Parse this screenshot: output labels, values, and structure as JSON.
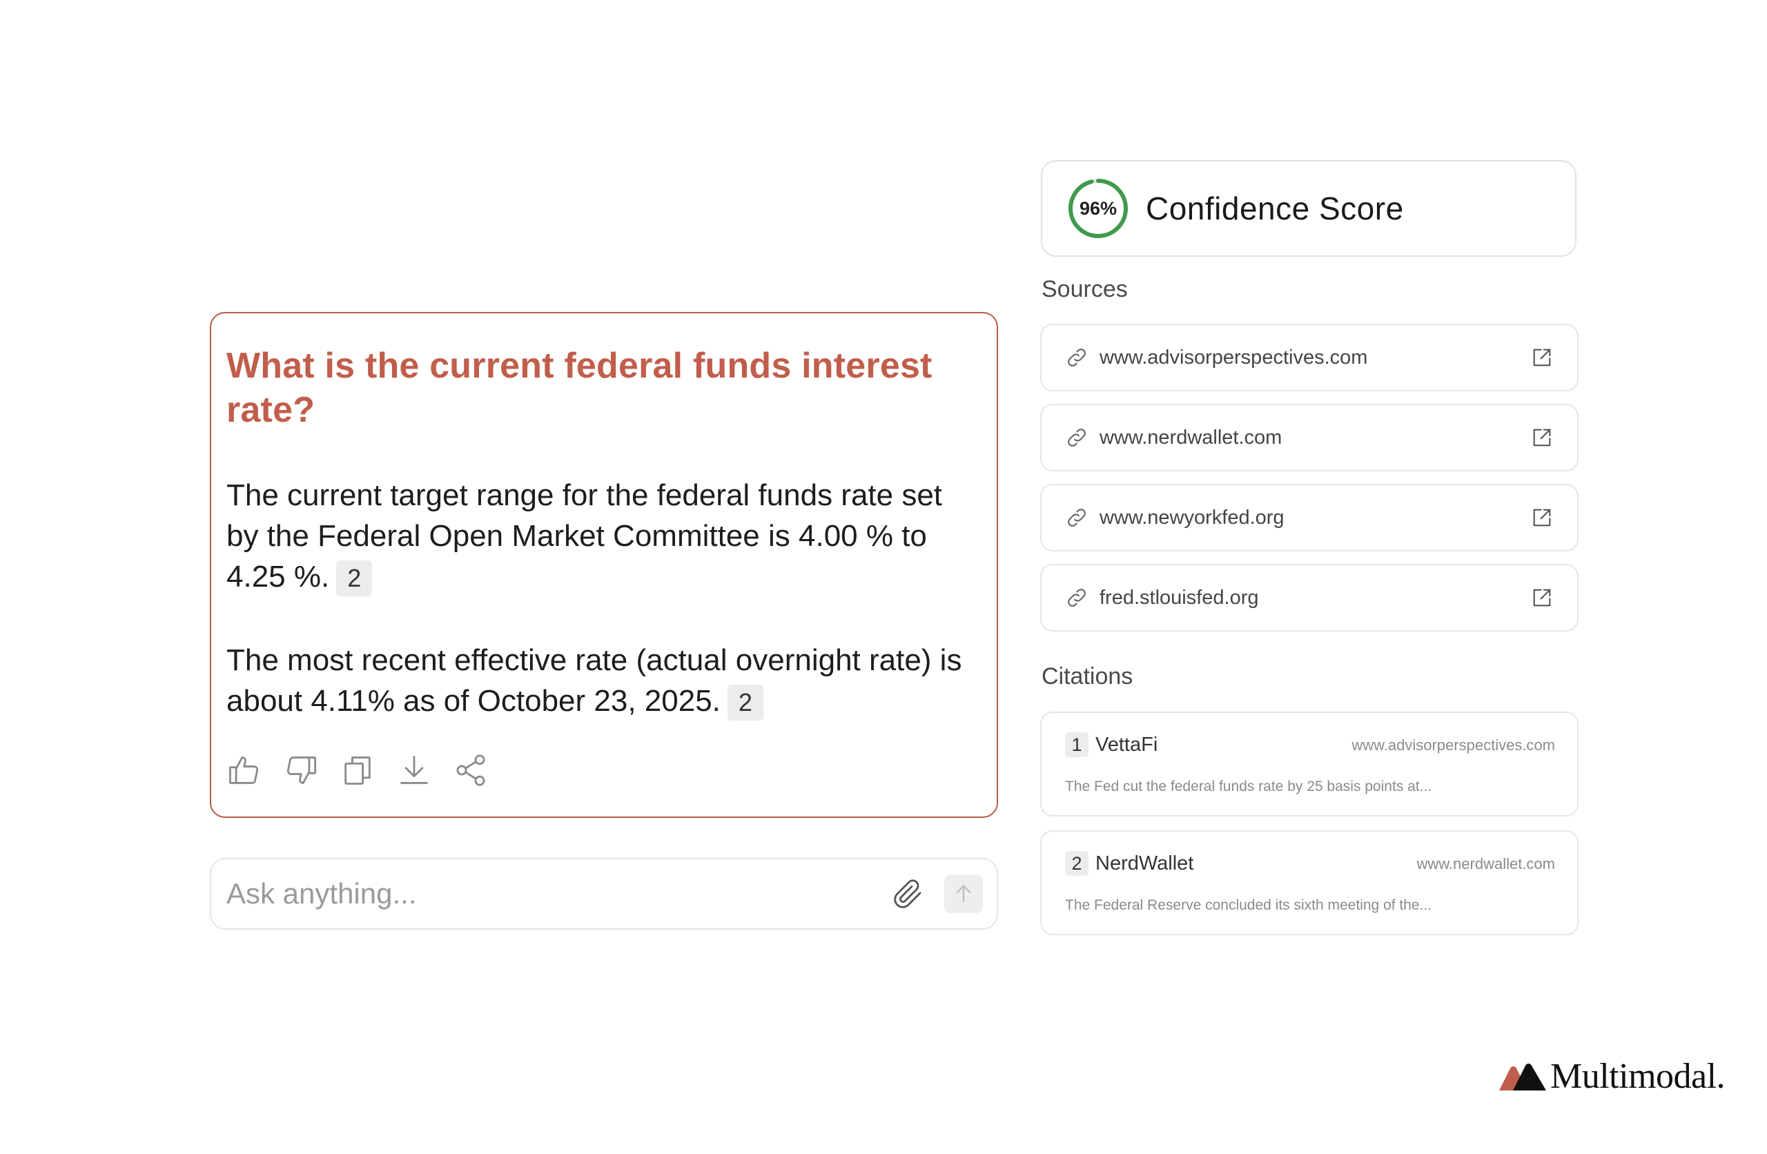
{
  "answer": {
    "question": "What is the current federal funds interest rate?",
    "paragraphs": [
      {
        "text": "The current target range for the federal funds rate set by the Federal Open Market Committee is 4.00 % to 4.25 %.",
        "citation": "2"
      },
      {
        "text": "The most recent effective rate (actual overnight rate) is about 4.11% as of October 23, 2025.",
        "citation": "2"
      }
    ],
    "actions": [
      "thumbs-up-icon",
      "thumbs-down-icon",
      "copy-icon",
      "download-icon",
      "share-icon"
    ]
  },
  "ask": {
    "placeholder": "Ask anything..."
  },
  "confidence": {
    "value": 96,
    "label": "96%",
    "title": "Confidence Score",
    "ring_color": "#3f9a4c"
  },
  "sources": {
    "title": "Sources",
    "items": [
      {
        "domain": "www.advisorperspectives.com"
      },
      {
        "domain": "www.nerdwallet.com"
      },
      {
        "domain": "www.newyorkfed.org"
      },
      {
        "domain": "fred.stlouisfed.org"
      }
    ]
  },
  "citations": {
    "title": "Citations",
    "items": [
      {
        "num": "1",
        "name": "VettaFi",
        "domain": "www.advisorperspectives.com",
        "snippet": "The Fed cut the federal funds rate by 25 basis points at..."
      },
      {
        "num": "2",
        "name": "NerdWallet",
        "domain": "www.nerdwallet.com",
        "snippet": "The Federal Reserve concluded its sixth meeting of the..."
      }
    ]
  },
  "brand": {
    "name": "Multimodal.",
    "colors": [
      "#c05e4b",
      "#111111"
    ]
  }
}
